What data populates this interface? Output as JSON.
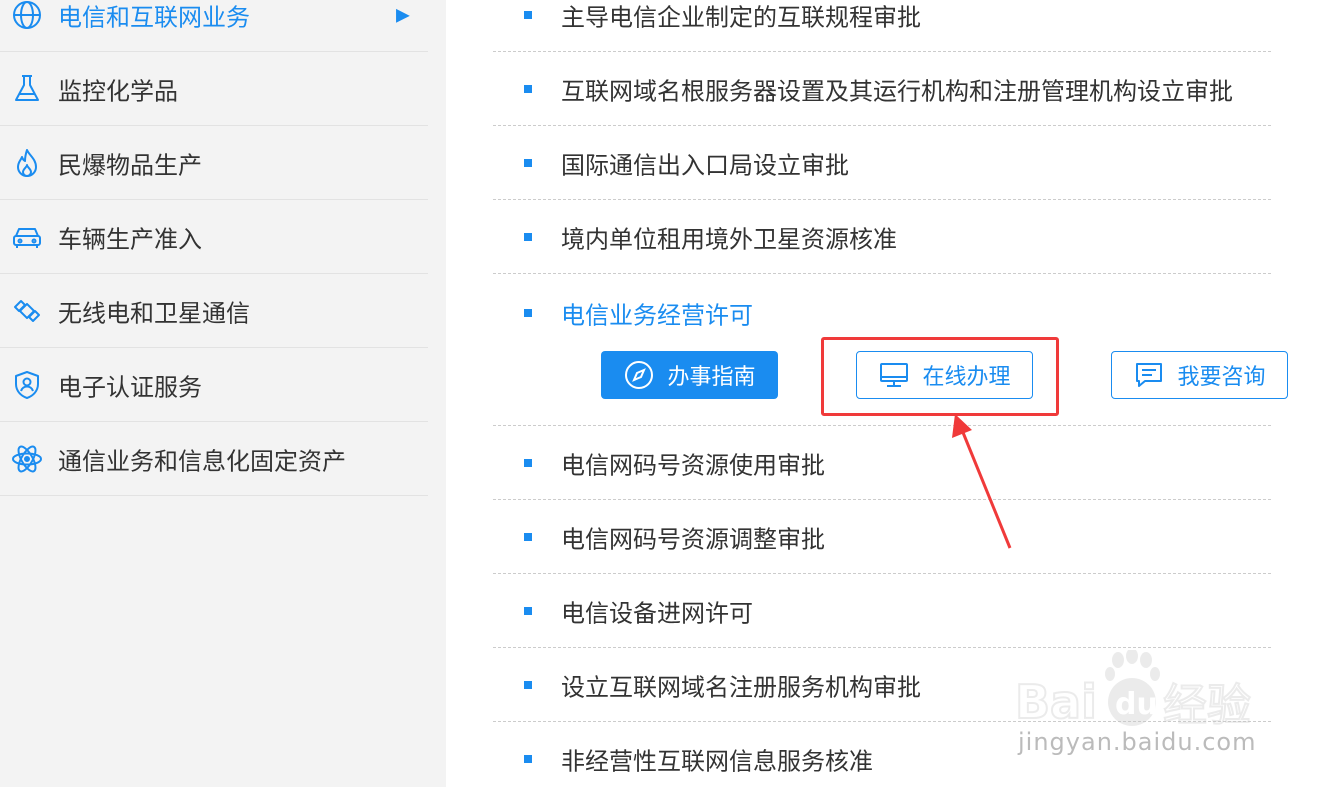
{
  "sidebar": {
    "items": [
      {
        "label": "电信和互联网业务",
        "icon": "globe-icon",
        "active": true,
        "arrow": "▶"
      },
      {
        "label": "监控化学品",
        "icon": "flask-icon"
      },
      {
        "label": "民爆物品生产",
        "icon": "flame-icon"
      },
      {
        "label": "车辆生产准入",
        "icon": "car-icon"
      },
      {
        "label": "无线电和卫星通信",
        "icon": "satellite-icon"
      },
      {
        "label": "电子认证服务",
        "icon": "shield-user-icon"
      },
      {
        "label": "通信业务和信息化固定资产",
        "icon": "atom-icon"
      }
    ]
  },
  "main": {
    "items": [
      "主导电信企业制定的互联规程审批",
      "互联网域名根服务器设置及其运行机构和注册管理机构设立审批",
      "国际通信出入口局设立审批",
      "境内单位租用境外卫星资源核准",
      "电信业务经营许可",
      "电信网码号资源使用审批",
      "电信网码号资源调整审批",
      "电信设备进网许可",
      "设立互联网域名注册服务机构审批",
      "非经营性互联网信息服务核准"
    ],
    "actions": {
      "guide": "办事指南",
      "online": "在线办理",
      "consult": "我要咨询"
    }
  },
  "watermark": {
    "brand": "Bai du 经验",
    "url": "jingyan.baidu.com"
  },
  "colors": {
    "accent": "#1a8cf0",
    "highlight": "#f03a3a"
  }
}
